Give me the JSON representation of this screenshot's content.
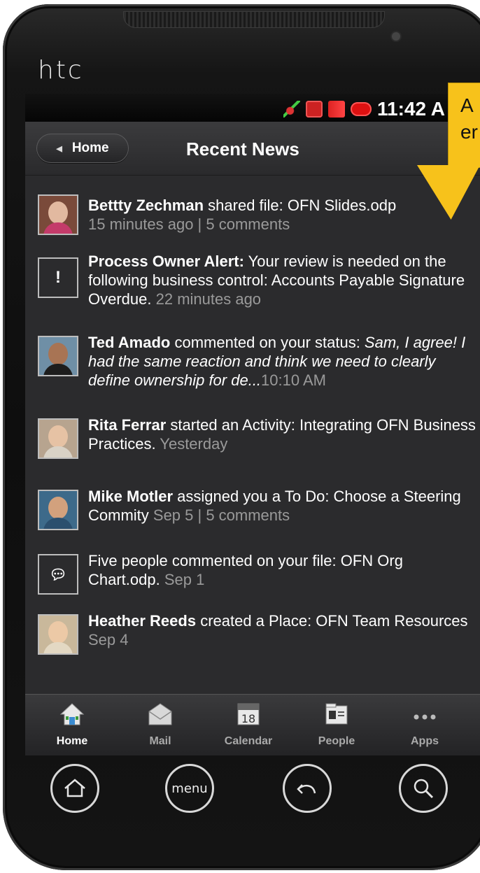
{
  "device": {
    "brand": "htc"
  },
  "status_bar": {
    "time": "11:42 A"
  },
  "header": {
    "back_label": "Home",
    "title": "Recent News"
  },
  "feed": [
    {
      "avatar": "photo",
      "author": "Bettty Zechman",
      "text": " shared file: OFN Slides.odp",
      "italic": "",
      "meta": "15 minutes ago | 5 comments"
    },
    {
      "avatar": "alert",
      "author": "Process Owner Alert:",
      "text": " Your review is needed on the following business control: Accounts Payable Signature Overdue.",
      "italic": "",
      "meta": "  22 minutes ago"
    },
    {
      "avatar": "photo",
      "author": "Ted Amado",
      "text": " commented on your status: ",
      "italic": "Sam, I agree! I had the same reaction and think we need to clearly define ownership for de...",
      "meta": "10:10 AM"
    },
    {
      "avatar": "photo",
      "author": "Rita Ferrar",
      "text": " started an Activity: Integrating OFN Business Practices.",
      "italic": "",
      "meta": " Yesterday"
    },
    {
      "avatar": "photo",
      "author": "Mike Motler",
      "text": " assigned you a To Do: Choose a Steering Commity",
      "italic": "",
      "meta": " Sep 5 | 5 comments"
    },
    {
      "avatar": "comment",
      "author": "",
      "text": "Five people commented on your file: OFN Org Chart.odp.",
      "italic": "",
      "meta": " Sep 1"
    },
    {
      "avatar": "photo",
      "author": "Heather Reeds",
      "text": " created a Place: OFN Team Resources",
      "italic": "",
      "meta": "  Sep 4"
    }
  ],
  "tabs": [
    {
      "label": "Home",
      "icon": "home-icon"
    },
    {
      "label": "Mail",
      "icon": "mail-icon"
    },
    {
      "label": "Calendar",
      "icon": "calendar-icon",
      "day": "18"
    },
    {
      "label": "People",
      "icon": "people-icon"
    },
    {
      "label": "Apps",
      "icon": "apps-icon"
    }
  ],
  "hardware": {
    "menu_label": "menu"
  },
  "callout": {
    "line1": "A",
    "line2": "er"
  },
  "colors": {
    "callout": "#f7c21b",
    "screen_bg": "#2b2b2d",
    "meta_text": "#9a9a9a"
  }
}
